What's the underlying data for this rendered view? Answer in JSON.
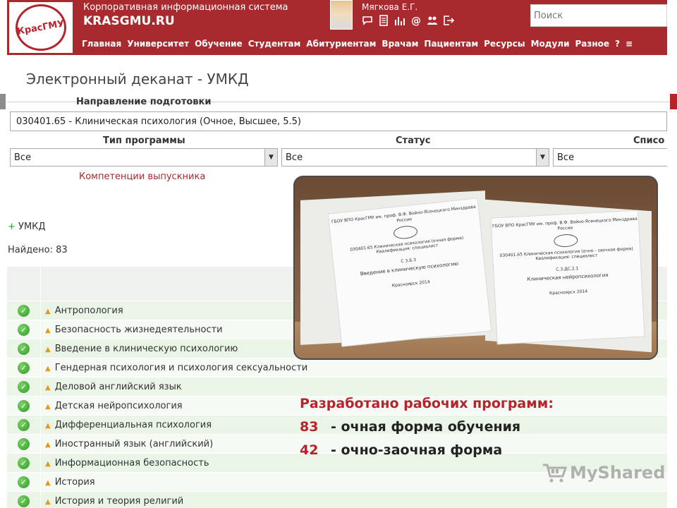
{
  "header": {
    "logo_text": "КрасГМУ",
    "system_name": "Корпоративная информационная система",
    "site": "KRASGMU.RU",
    "user_name": "Мягкова Е.Г.",
    "search_placeholder": "Поиск",
    "user_icons": [
      "chat-icon",
      "document-icon",
      "stats-icon",
      "email-icon",
      "users-icon",
      "logout-icon"
    ],
    "nav": [
      "Главная",
      "Университет",
      "Обучение",
      "Студентам",
      "Абитуриентам",
      "Врачам",
      "Пациентам",
      "Ресурсы",
      "Модули",
      "Разное",
      "?",
      "≡"
    ]
  },
  "page_title": "Электронный деканат - УМКД",
  "filters": {
    "direction_label": "Направление подготовки",
    "direction_value": "030401.65 - Клиническая психология (Очное, Высшее, 5.5)",
    "program_type_label": "Тип программы",
    "program_type_value": "Все",
    "status_label": "Статус",
    "status_value": "Все",
    "list_label": "Списо",
    "list_value": "Все",
    "competencies_link": "Компетенции выпускника"
  },
  "umkd_toggle": "УМКД",
  "umkd_plus": "+",
  "found_text": "Найдено: 83",
  "table": {
    "rows": [
      "Антропология",
      "Безопасность жизнедеятельности",
      "Введение в клиническую психологию",
      "Гендерная психология и психология сексуальности",
      "Деловой английский язык",
      "Детская нейропсихология",
      "Дифференциальная психология",
      "Иностранный язык (английский)",
      "Информационная безопасность",
      "История",
      "История и теория религий"
    ]
  },
  "photo": {
    "sheet1": {
      "org": "ГБОУ ВПО КрасГМУ им. проф. В.Ф. Войно-Ясенецкого Минздрава России",
      "specialty": "030401.65 Клиническая психология (очная форма) Квалификация: специалист",
      "code": "С 3.Б.3",
      "subject": "Введение в клиническую психологию",
      "city": "Красноярск 2014"
    },
    "sheet2": {
      "org": "ГБОУ ВПО КрасГМУ им. проф. В.Ф. Войно-Ясенецкого Минздрава России",
      "specialty": "030401.65 Клиническая психология (очно - заочная форма) Квалификация: специалист",
      "code": "С.3.ДС.2.1",
      "subject": "Клиническая нейропсихология",
      "city": "Красноярск 2014"
    }
  },
  "caption": {
    "title": "Разработано рабочих программ:",
    "line1_num": "83",
    "line1_text": "- очная форма обучения",
    "line2_num": "42",
    "line2_text": "- очно-заочная форма"
  },
  "watermark": "MyShared",
  "colors": {
    "brand": "#a82a2e",
    "accent": "#b5242b",
    "row_odd": "#eaf5e7",
    "row_even": "#f5fbf4"
  }
}
